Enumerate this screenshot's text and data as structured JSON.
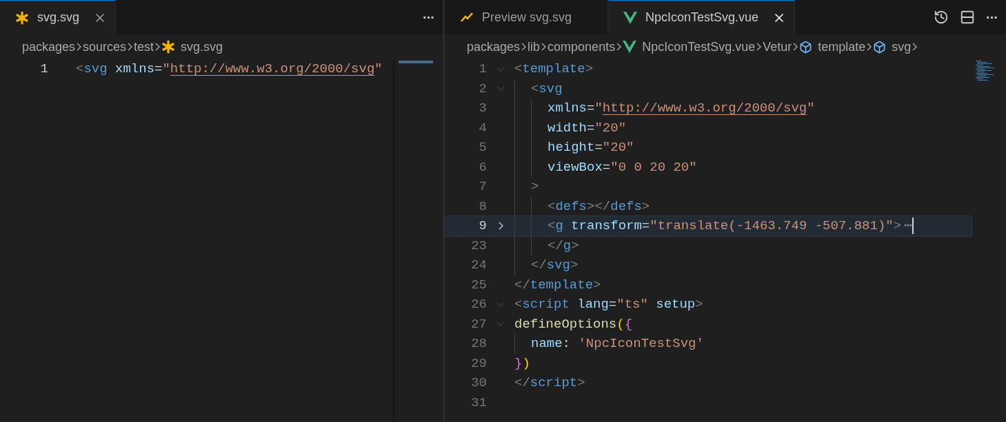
{
  "left_group": {
    "tabs": [
      {
        "label": "svg.svg",
        "kind": "svg",
        "selected": true
      }
    ],
    "more_actions": "···",
    "breadcrumbs": [
      {
        "label": "packages"
      },
      {
        "label": "sources"
      },
      {
        "label": "test"
      },
      {
        "label": "svg.svg",
        "kind": "svg"
      }
    ],
    "editor": {
      "focused": false,
      "lines": [
        {
          "number": "1",
          "current": true,
          "tokens": [
            {
              "kind": "punct",
              "text": "<"
            },
            {
              "kind": "tag",
              "text": "svg"
            },
            {
              "kind": "attr",
              "text": " xmlns"
            },
            {
              "kind": "eq",
              "text": "="
            },
            {
              "kind": "string",
              "text": "\""
            },
            {
              "kind": "link",
              "text": "http://www.w3.org/2000/svg"
            },
            {
              "kind": "string",
              "text": "\""
            }
          ]
        }
      ]
    }
  },
  "right_group": {
    "tabs": [
      {
        "label": "Preview svg.svg",
        "kind": "preview",
        "selected": false
      },
      {
        "label": "NpcIconTestSvg.vue",
        "kind": "vue",
        "selected": true
      }
    ],
    "more_actions": "···",
    "breadcrumbs": [
      {
        "label": "packages"
      },
      {
        "label": "lib"
      },
      {
        "label": "components"
      },
      {
        "label": "NpcIconTestSvg.vue",
        "kind": "vue"
      },
      {
        "label": "Vetur"
      },
      {
        "label": "template",
        "kind": "symbol"
      },
      {
        "label": "svg",
        "kind": "symbol"
      }
    ],
    "editor": {
      "focused": true,
      "lines": [
        {
          "number": "1",
          "current": false,
          "collapsed": false,
          "tokens": [
            {
              "kind": "punct",
              "text": "<"
            },
            {
              "kind": "tag",
              "text": "template"
            },
            {
              "kind": "punct",
              "text": ">"
            }
          ],
          "children": [
            {
              "number": "2",
              "current": false,
              "collapsed": false,
              "tokens": [
                {
                  "kind": "punct",
                  "text": "<"
                },
                {
                  "kind": "tag",
                  "text": "svg"
                }
              ],
              "children": [
                {
                  "number": "3",
                  "current": false,
                  "tokens": [
                    {
                      "kind": "attr",
                      "text": "xmlns"
                    },
                    {
                      "kind": "eq",
                      "text": "="
                    },
                    {
                      "kind": "string",
                      "text": "\""
                    },
                    {
                      "kind": "link",
                      "text": "http://www.w3.org/2000/svg"
                    },
                    {
                      "kind": "string",
                      "text": "\""
                    }
                  ]
                },
                {
                  "number": "4",
                  "current": false,
                  "tokens": [
                    {
                      "kind": "attr",
                      "text": "width"
                    },
                    {
                      "kind": "eq",
                      "text": "="
                    },
                    {
                      "kind": "string",
                      "text": "\"20\""
                    }
                  ]
                },
                {
                  "number": "5",
                  "current": false,
                  "tokens": [
                    {
                      "kind": "attr",
                      "text": "height"
                    },
                    {
                      "kind": "eq",
                      "text": "="
                    },
                    {
                      "kind": "string",
                      "text": "\"20\""
                    }
                  ]
                },
                {
                  "number": "6",
                  "current": false,
                  "tokens": [
                    {
                      "kind": "attr",
                      "text": "viewBox"
                    },
                    {
                      "kind": "eq",
                      "text": "="
                    },
                    {
                      "kind": "string",
                      "text": "\"0 0 20 20\""
                    }
                  ]
                }
              ]
            },
            {
              "number": "7",
              "current": false,
              "tokens": [
                {
                  "kind": "punct",
                  "text": ">"
                }
              ],
              "children": [
                {
                  "number": "8",
                  "current": false,
                  "tokens": [
                    {
                      "kind": "punct",
                      "text": "<"
                    },
                    {
                      "kind": "tag",
                      "text": "defs"
                    },
                    {
                      "kind": "punct",
                      "text": "></"
                    },
                    {
                      "kind": "tag",
                      "text": "defs"
                    },
                    {
                      "kind": "punct",
                      "text": ">"
                    }
                  ]
                },
                {
                  "number": "9",
                  "current": true,
                  "collapsed": true,
                  "tokens": [
                    {
                      "kind": "punct",
                      "text": "<"
                    },
                    {
                      "kind": "tag",
                      "text": "g"
                    },
                    {
                      "kind": "attr",
                      "text": " transform"
                    },
                    {
                      "kind": "eq",
                      "text": "="
                    },
                    {
                      "kind": "string",
                      "text": "\"translate(-1463.749 -507.881)\""
                    },
                    {
                      "kind": "punct",
                      "text": ">"
                    },
                    {
                      "kind": "ellipsis",
                      "text": "⋯"
                    }
                  ]
                },
                {
                  "number": "23",
                  "current": false,
                  "tokens": [
                    {
                      "kind": "punct",
                      "text": "</"
                    },
                    {
                      "kind": "tag",
                      "text": "g"
                    },
                    {
                      "kind": "punct",
                      "text": ">"
                    }
                  ]
                }
              ]
            },
            {
              "number": "24",
              "current": false,
              "tokens": [
                {
                  "kind": "punct",
                  "text": "</"
                },
                {
                  "kind": "tag",
                  "text": "svg"
                },
                {
                  "kind": "punct",
                  "text": ">"
                }
              ]
            }
          ]
        },
        {
          "number": "25",
          "current": false,
          "tokens": [
            {
              "kind": "punct",
              "text": "</"
            },
            {
              "kind": "tag",
              "text": "template"
            },
            {
              "kind": "punct",
              "text": ">"
            }
          ]
        },
        {
          "number": "26",
          "current": false,
          "collapsed": false,
          "tokens": [
            {
              "kind": "punct",
              "text": "<"
            },
            {
              "kind": "tag",
              "text": "script"
            },
            {
              "kind": "attr",
              "text": " lang"
            },
            {
              "kind": "eq",
              "text": "="
            },
            {
              "kind": "string",
              "text": "\"ts\""
            },
            {
              "kind": "attr",
              "text": " setup"
            },
            {
              "kind": "punct",
              "text": ">"
            }
          ]
        },
        {
          "number": "27",
          "current": false,
          "collapsed": false,
          "tokens": [
            {
              "kind": "func",
              "text": "defineOptions"
            },
            {
              "kind": "brace1",
              "text": "("
            },
            {
              "kind": "brace2",
              "text": "{"
            }
          ],
          "children": [
            {
              "number": "28",
              "current": false,
              "tokens": [
                {
                  "kind": "attr",
                  "text": "name"
                },
                {
                  "kind": "eq",
                  "text": ": "
                },
                {
                  "kind": "string",
                  "text": "'NpcIconTestSvg'"
                }
              ]
            }
          ]
        },
        {
          "number": "29",
          "current": false,
          "tokens": [
            {
              "kind": "brace2",
              "text": "}"
            },
            {
              "kind": "brace1",
              "text": ")"
            }
          ]
        },
        {
          "number": "30",
          "current": false,
          "tokens": [
            {
              "kind": "punct",
              "text": "</"
            },
            {
              "kind": "tag",
              "text": "script"
            },
            {
              "kind": "punct",
              "text": ">"
            }
          ]
        },
        {
          "number": "31",
          "current": false
        }
      ]
    }
  }
}
